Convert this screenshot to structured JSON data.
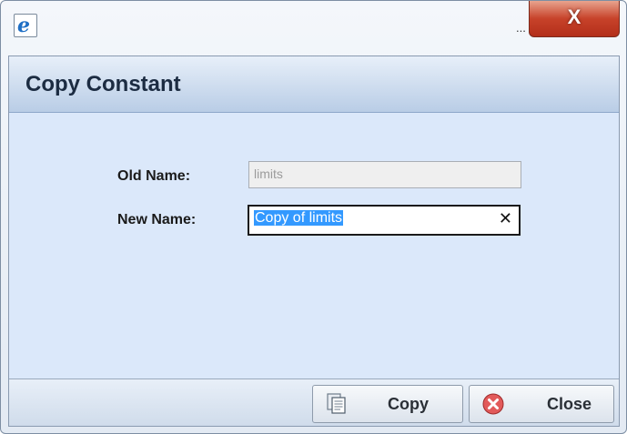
{
  "window": {
    "title_ellipsis": "...",
    "close_glyph": "X"
  },
  "dialog": {
    "title": "Copy Constant",
    "old_name_label": "Old Name:",
    "old_name_value": "limits",
    "new_name_label": "New Name:",
    "new_name_value": "Copy of limits",
    "clear_glyph": "✕"
  },
  "buttons": {
    "copy_label": "Copy",
    "close_label": "Close"
  },
  "icons": {
    "app": "internet-explorer-icon",
    "copy": "copy-document-icon",
    "close": "red-circle-x-icon"
  },
  "colors": {
    "close_button": "#c7422a",
    "header": "#b9cde6",
    "body": "#dbe8fa",
    "selection": "#3399ff"
  }
}
